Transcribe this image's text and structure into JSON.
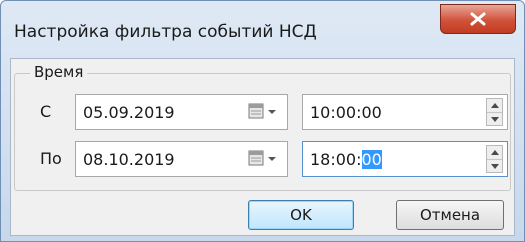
{
  "window": {
    "title": "Настройка фильтра событий НСД"
  },
  "group": {
    "label": "Время"
  },
  "from": {
    "label": "С",
    "date": "05.09.2019",
    "time": "10:00:00"
  },
  "to": {
    "label": "По",
    "date": "08.10.2019",
    "time_prefix": "18:00:",
    "time_selected": "00"
  },
  "buttons": {
    "ok": "OK",
    "cancel": "Отмена"
  },
  "colors": {
    "selection": "#3399ff",
    "close": "#c23b22",
    "accent": "#3c7fb1"
  }
}
